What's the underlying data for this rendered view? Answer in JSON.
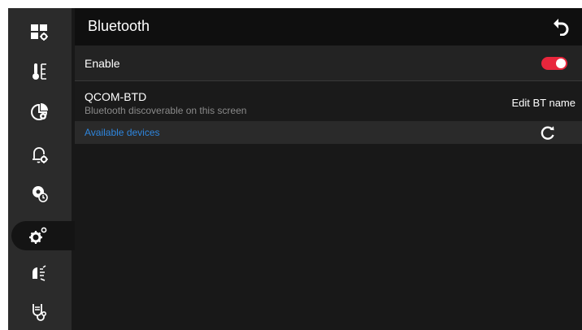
{
  "header": {
    "title": "Bluetooth",
    "back_icon": "back-arrow-icon"
  },
  "enable_row": {
    "label": "Enable",
    "toggle_on": true,
    "toggle_color": "#e8263c"
  },
  "device_row": {
    "name": "QCOM-BTD",
    "subtitle": "Bluetooth discoverable on this screen",
    "action_label": "Edit BT name"
  },
  "available_row": {
    "label": "Available devices",
    "label_color": "#2e86de",
    "refresh_icon": "refresh-icon"
  },
  "sidebar": {
    "items": [
      {
        "icon": "dashboard-settings-icon"
      },
      {
        "icon": "temperature-icon"
      },
      {
        "icon": "pie-settings-icon"
      },
      {
        "icon": "alarm-settings-icon"
      },
      {
        "icon": "timer-settings-icon"
      },
      {
        "icon": "gears-icon",
        "active": true
      },
      {
        "icon": "network-signal-icon"
      },
      {
        "icon": "stethoscope-icon"
      }
    ]
  }
}
